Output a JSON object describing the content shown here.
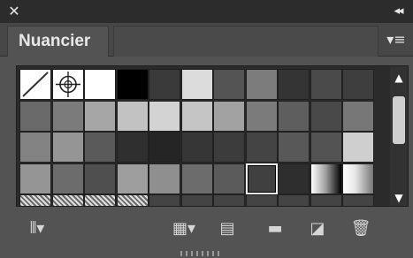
{
  "window": {
    "close_glyph": "✕",
    "collapse_glyph": "◂◂"
  },
  "panel": {
    "tab_title": "Nuancier",
    "menu_glyph": "▾≡"
  },
  "swatches": {
    "rows": [
      [
        "none",
        "registration",
        "#ffffff",
        "#000000",
        "#3a3a3a",
        "#dcdcdc",
        "#545454",
        "#7c7c7c",
        "#343434",
        "#4a4a4a",
        "#3e3e3e"
      ],
      [
        "#6a6a6a",
        "#7b7b7b",
        "#a6a6a6",
        "#c2c2c2",
        "#d3d3d3",
        "#c5c5c5",
        "#a2a2a2",
        "#7b7b7b",
        "#5e5e5e",
        "#494949",
        "#777777"
      ],
      [
        "#838383",
        "#959595",
        "#5a5a5a",
        "#2f2f2f",
        "#252525",
        "#363636",
        "#3c3c3c",
        "#444444",
        "#585858",
        "#535353",
        "#cfcfcf"
      ],
      [
        "#959595",
        "#6c6c6c",
        "#4f4f4f",
        "#9e9e9e",
        "#8f8f8f",
        "#6c6c6c",
        "#5b5b5b",
        "#404040",
        "#2e2e2e",
        "gradient1",
        "gradient2"
      ],
      [
        "pattern",
        "pattern",
        "pattern",
        "pattern",
        "#444444",
        "#444444",
        "#444444",
        "#444444",
        "#444444",
        "#444444",
        "#444444"
      ]
    ],
    "selected": [
      3,
      7
    ]
  },
  "scrollbar": {
    "up_glyph": "▲",
    "down_glyph": "▼"
  },
  "toolbar": {
    "library_glyph": "⫴▾",
    "show_kinds_glyph": "▦▾",
    "swatch_options_glyph": "▤",
    "new_group_glyph": "▬",
    "new_swatch_glyph": "◪",
    "delete_glyph": "🗑"
  }
}
